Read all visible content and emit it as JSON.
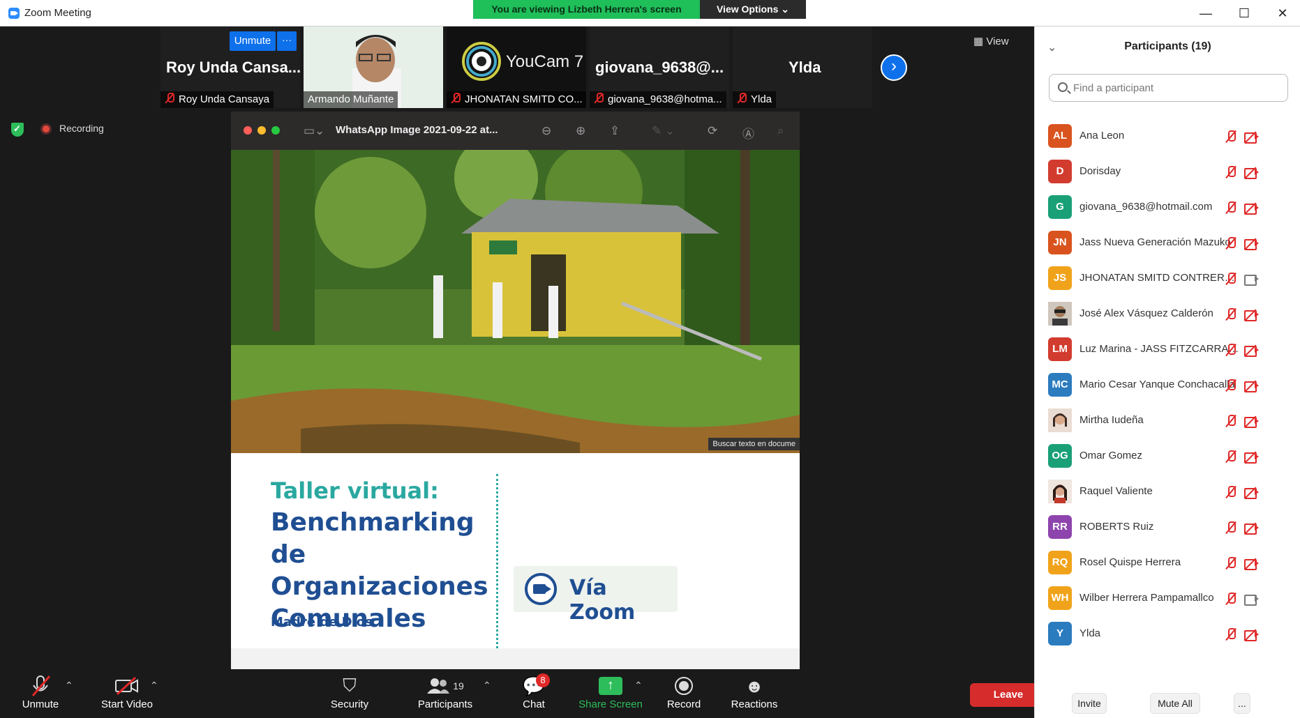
{
  "window": {
    "title": "Zoom Meeting",
    "banner": "You are viewing Lizbeth Herrera's screen",
    "view_options": "View Options",
    "minimize": "—",
    "maximize": "☐",
    "close": "✕"
  },
  "strip": {
    "unmute_label": "Unmute",
    "more_label": "···",
    "view_label": "View",
    "tiles": [
      {
        "big": "Roy Unda Cansa...",
        "name": "Roy Unda Cansaya",
        "muted": true
      },
      {
        "big": "",
        "name": "Armando Muñante",
        "muted": false
      },
      {
        "big": "",
        "name": "JHONATAN SMITD CO...",
        "muted": true
      },
      {
        "big": "giovana_9638@...",
        "name": "giovana_9638@hotma...",
        "muted": true
      },
      {
        "big": "Ylda",
        "name": "Ylda",
        "muted": true
      }
    ]
  },
  "recording": {
    "label": "Recording"
  },
  "shared_window": {
    "title": "WhatsApp Image 2021-09-22 at...",
    "overlay_hint": "Buscar texto en docume",
    "slide": {
      "line1": "Taller virtual:",
      "line2": "Benchmarking de Organizaciones Comunales",
      "line3": "Madre de Dios",
      "badge": "Vía Zoom"
    }
  },
  "toolbar": {
    "unmute": "Unmute",
    "start_video": "Start Video",
    "security": "Security",
    "participants": "Participants",
    "participants_count": "19",
    "chat": "Chat",
    "chat_badge": "8",
    "share_screen": "Share Screen",
    "record": "Record",
    "reactions": "Reactions",
    "leave": "Leave"
  },
  "panel": {
    "title": "Participants (19)",
    "search_placeholder": "Find a participant",
    "invite": "Invite",
    "mute_all": "Mute All",
    "more": "...",
    "participants": [
      {
        "initials": "AL",
        "name": "Ana Leon",
        "color": "#d9531e",
        "video_on": false
      },
      {
        "initials": "D",
        "name": "Dorisday",
        "color": "#d23c2f",
        "video_on": false
      },
      {
        "initials": "G",
        "name": "giovana_9638@hotmail.com",
        "color": "#1aa076",
        "video_on": false
      },
      {
        "initials": "JN",
        "name": "Jass Nueva Generación  Mazuko",
        "color": "#d9531e",
        "video_on": false
      },
      {
        "initials": "JS",
        "name": "JHONATAN SMITD CONTRERAS ...",
        "color": "#f0a31a",
        "video_on": true
      },
      {
        "initials": "",
        "name": "José Alex Vásquez Calderón",
        "color": "#8a7a6a",
        "video_on": false
      },
      {
        "initials": "LM",
        "name": "Luz Marina - JASS FITZCARRALD",
        "color": "#d23c2f",
        "video_on": false
      },
      {
        "initials": "MC",
        "name": "Mario Cesar Yanque Conchacalla",
        "color": "#2b7bbf",
        "video_on": false
      },
      {
        "initials": "",
        "name": "Mirtha Iudeña",
        "color": "#c9a08a",
        "video_on": false
      },
      {
        "initials": "OG",
        "name": "Omar Gomez",
        "color": "#1aa076",
        "video_on": false
      },
      {
        "initials": "",
        "name": "Raquel Valiente",
        "color": "#b87a6a",
        "video_on": false
      },
      {
        "initials": "RR",
        "name": "ROBERTS Ruiz",
        "color": "#8e44ad",
        "video_on": false
      },
      {
        "initials": "RQ",
        "name": "Rosel Quispe Herrera",
        "color": "#f0a31a",
        "video_on": false
      },
      {
        "initials": "WH",
        "name": "Wilber Herrera Pampamallco",
        "color": "#f0a31a",
        "video_on": true
      },
      {
        "initials": "Y",
        "name": "Ylda",
        "color": "#2b7bbf",
        "video_on": false
      }
    ]
  }
}
